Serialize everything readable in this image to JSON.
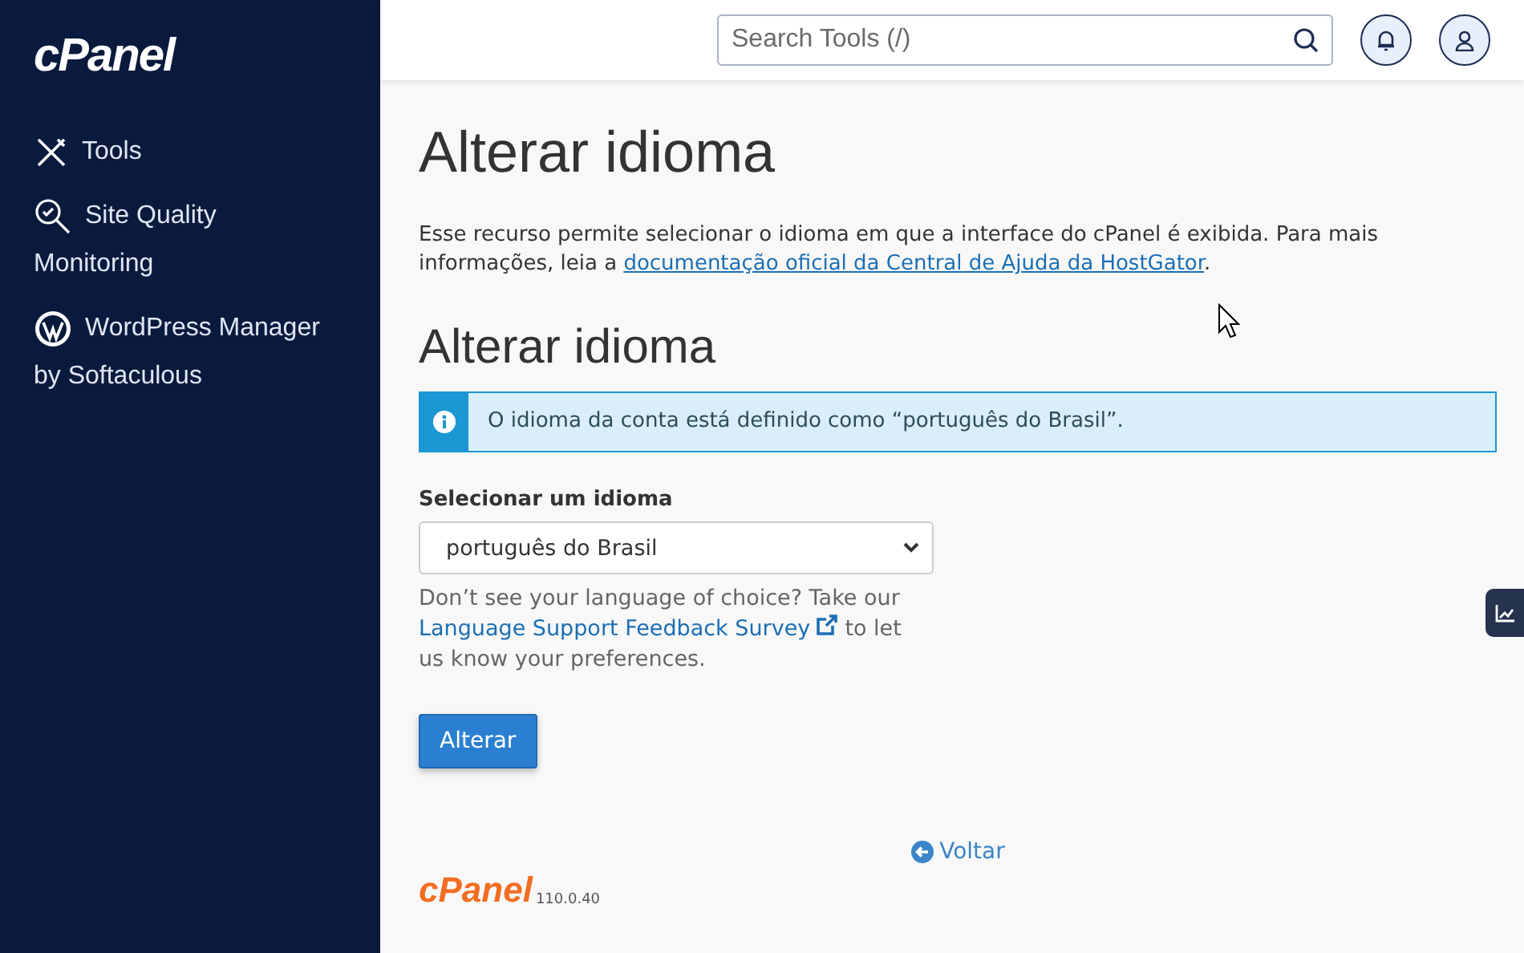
{
  "sidebar": {
    "logo": "cPanel",
    "items": [
      {
        "kind": "tools",
        "label": "Tools"
      },
      {
        "kind": "quality",
        "label": "Site Quality Monitoring"
      },
      {
        "kind": "wordpress",
        "label": "WordPress Manager by Softaculous"
      }
    ]
  },
  "header": {
    "search": {
      "placeholder": "Search Tools (/)"
    }
  },
  "page": {
    "title": "Alterar idioma",
    "intro": "Esse recurso permite selecionar o idioma em que a interface do cPanel é exibida. Para mais informações, leia a ",
    "intro_link": "documentação oficial da Central de Ajuda da HostGator",
    "intro_end": ".",
    "section_title": "Alterar idioma",
    "info": "O idioma da conta está definido como “português do Brasil”.",
    "select_label": "Selecionar um idioma",
    "select_value": "português do Brasil",
    "help_before": "Don’t see your language of choice? Take our ",
    "help_link": "Language Support Feedback Survey",
    "help_after": " to let us know your preferences.",
    "button": "Alterar",
    "back": "Voltar"
  },
  "footer": {
    "logo": "cPanel",
    "version": "110.0.40"
  }
}
